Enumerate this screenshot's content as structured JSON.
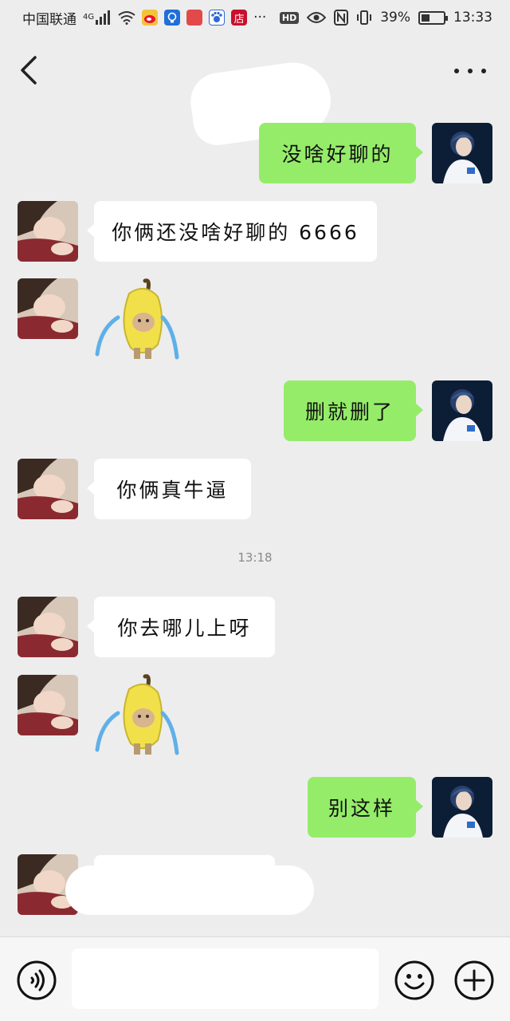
{
  "status_bar": {
    "carrier": "中国联通",
    "network": "4G",
    "hd": "HD",
    "battery": "39%",
    "battery_level": 0.39,
    "time": "13:33",
    "app_icons": [
      "wifi-icon",
      "weibo-icon",
      "bulb-icon",
      "huawei-icon",
      "baidu-icon",
      "shop-icon"
    ],
    "shop_glyph": "店",
    "more": "···"
  },
  "header": {
    "back_icon": "chevron-left-icon",
    "more_icon": "ellipsis-icon"
  },
  "messages": [
    {
      "side": "right",
      "text": "没啥好聊的"
    },
    {
      "side": "left",
      "text": "你俩还没啥好聊的 6666"
    },
    {
      "side": "left",
      "sticker": "crying-banana-cat-sticker"
    },
    {
      "side": "right",
      "text": "删就删了"
    },
    {
      "side": "left",
      "text": "你俩真牛逼"
    },
    {
      "side": "left",
      "text": "你去哪儿上呀"
    },
    {
      "side": "left",
      "sticker": "crying-banana-cat-sticker"
    },
    {
      "side": "right",
      "text": "别这样"
    }
  ],
  "timestamp": "13:18",
  "input": {
    "value": "",
    "voice_icon": "voice-icon",
    "emoji_icon": "emoji-icon",
    "plus_icon": "plus-icon"
  },
  "colors": {
    "background": "#ededed",
    "my_bubble": "#95ec69",
    "their_bubble": "#ffffff"
  }
}
